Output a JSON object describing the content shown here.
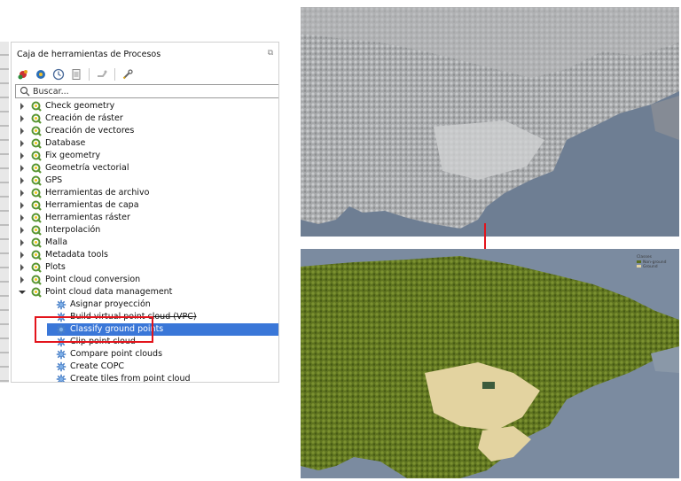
{
  "panel": {
    "title": "Caja de herramientas de Procesos",
    "search_placeholder": "Buscar..."
  },
  "tree": {
    "groups": [
      "Check geometry",
      "Creación de ráster",
      "Creación de vectores",
      "Database",
      "Fix geometry",
      "Geometría vectorial",
      "GPS",
      "Herramientas de archivo",
      "Herramientas de capa",
      "Herramientas ráster",
      "Interpolación",
      "Malla",
      "Metadata tools",
      "Plots",
      "Point cloud conversion",
      "Point cloud data management"
    ],
    "children": [
      "Asignar proyección",
      "Build virtual point cloud (VPC)",
      "Classify ground points",
      "Clip point cloud",
      "Compare point clouds",
      "Create COPC",
      "Create tiles from point cloud"
    ],
    "selected_child": "Classify ground points"
  },
  "legend": {
    "title": "Classes",
    "items": [
      {
        "label": "Non-ground",
        "color": "#5a6e1e"
      },
      {
        "label": "Ground",
        "color": "#e3d3a0"
      }
    ]
  },
  "colors": {
    "selection": "#3a77d8",
    "highlight_box": "#e3141c",
    "arrow": "#e3141c",
    "qgis_green": "#589632"
  }
}
